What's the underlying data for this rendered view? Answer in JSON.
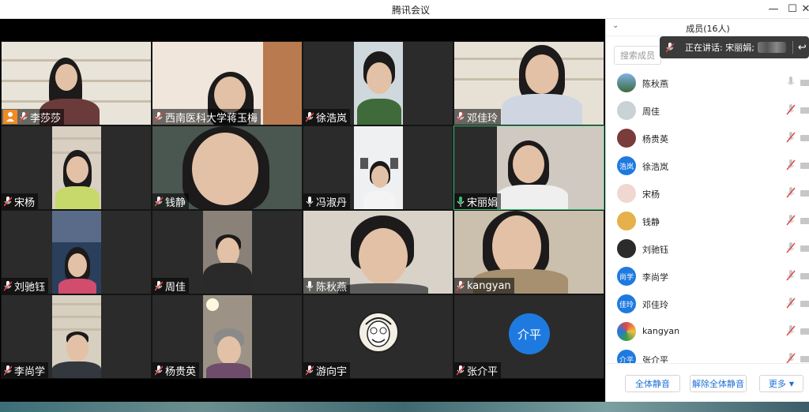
{
  "window": {
    "title": "腾讯会议"
  },
  "panel": {
    "title": "成员(16人)",
    "search_placeholder": "搜索成员",
    "speaking_label": "正在讲话: 宋丽娟;",
    "buttons": {
      "mute_all": "全体静音",
      "unmute_all": "解除全体静音",
      "more": "更多"
    }
  },
  "tiles": [
    {
      "name": "李莎莎",
      "host": true
    },
    {
      "name": "西南医科大学蒋玉梅"
    },
    {
      "name": "徐浩岚"
    },
    {
      "name": "邓佳玲"
    },
    {
      "name": "宋杨"
    },
    {
      "name": "钱静"
    },
    {
      "name": "冯淑丹"
    },
    {
      "name": "宋丽娟",
      "active": true
    },
    {
      "name": "刘驰钰"
    },
    {
      "name": "周佳"
    },
    {
      "name": "陈秋燕"
    },
    {
      "name": "kangyan"
    },
    {
      "name": "李尚学"
    },
    {
      "name": "杨贵英"
    },
    {
      "name": "游向宇"
    },
    {
      "name": "张介平",
      "initials": "介平"
    }
  ],
  "members": [
    {
      "name": "陈秋燕",
      "mic": "on"
    },
    {
      "name": "周佳",
      "mic": "muted"
    },
    {
      "name": "杨贵英",
      "mic": "muted"
    },
    {
      "name": "徐浩岚",
      "mic": "muted",
      "initials": "浩岚"
    },
    {
      "name": "宋杨",
      "mic": "muted"
    },
    {
      "name": "钱静",
      "mic": "muted"
    },
    {
      "name": "刘驰钰",
      "mic": "muted"
    },
    {
      "name": "李尚学",
      "mic": "muted",
      "initials": "尚学"
    },
    {
      "name": "邓佳玲",
      "mic": "muted",
      "initials": "佳玲"
    },
    {
      "name": "kangyan",
      "mic": "muted"
    },
    {
      "name": "张介平",
      "mic": "muted",
      "initials": "介平"
    }
  ],
  "colors": {
    "accent": "#1f7ae0",
    "active_border": "#2fbf71",
    "host_badge": "#f08a24",
    "muted_red": "#e04848"
  }
}
